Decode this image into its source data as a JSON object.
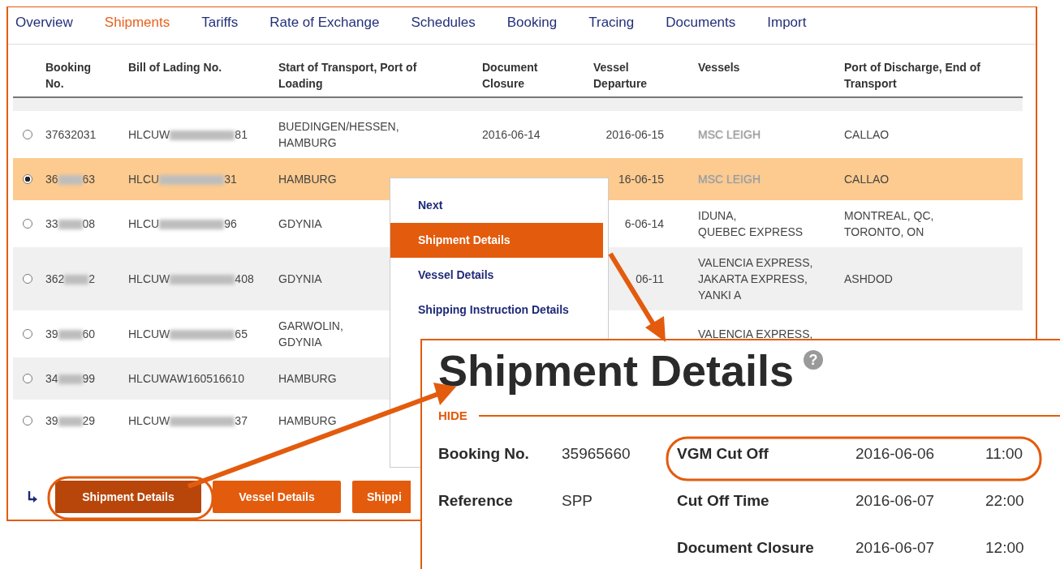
{
  "tabs": [
    {
      "label": "Overview",
      "selected": false
    },
    {
      "label": "Shipments",
      "selected": true
    },
    {
      "label": "Tariffs",
      "selected": false
    },
    {
      "label": "Rate of Exchange",
      "selected": false
    },
    {
      "label": "Schedules",
      "selected": false
    },
    {
      "label": "Booking",
      "selected": false
    },
    {
      "label": "Tracing",
      "selected": false
    },
    {
      "label": "Documents",
      "selected": false
    },
    {
      "label": "Import",
      "selected": false
    }
  ],
  "table": {
    "columns": [
      "Booking No.",
      "Bill of Lading No.",
      "Start of Transport, Port of Loading",
      "Document Closure",
      "Vessel Departure",
      "Vessels",
      "Port of Discharge, End of Transport"
    ],
    "rows": [
      {
        "selected": false,
        "booking_no": [
          "37632031"
        ],
        "bill_of_lading_no": [
          "HLCUW",
          "81"
        ],
        "start_of_transport": [
          "BUEDINGEN/HESSEN,",
          "HAMBURG"
        ],
        "document_closure": [
          "2016-06-14"
        ],
        "vessel_departure": [
          "2016-06-15"
        ],
        "vessels": [
          "MSC LEIGH"
        ],
        "port_of_discharge": [
          "CALLAO"
        ]
      },
      {
        "selected": true,
        "booking_no": [
          "36",
          "63"
        ],
        "bill_of_lading_no": [
          "HLCU",
          "31"
        ],
        "start_of_transport": [
          "HAMBURG"
        ],
        "vessel_departure": [
          "16-06-15"
        ],
        "vessels": [
          "MSC LEIGH"
        ],
        "port_of_discharge": [
          "CALLAO"
        ]
      },
      {
        "selected": false,
        "booking_no": [
          "33",
          "08"
        ],
        "bill_of_lading_no": [
          "HLCU",
          "96"
        ],
        "start_of_transport": [
          "GDYNIA"
        ],
        "vessel_departure": [
          "6-06-14"
        ],
        "vessels": [
          "IDUNA,",
          "QUEBEC EXPRESS"
        ],
        "port_of_discharge": [
          "MONTREAL, QC,",
          "TORONTO, ON"
        ]
      },
      {
        "selected": false,
        "booking_no": [
          "362",
          "2"
        ],
        "bill_of_lading_no": [
          "HLCUW",
          "408"
        ],
        "start_of_transport": [
          "GDYNIA"
        ],
        "vessel_departure": [
          "06-11"
        ],
        "vessels": [
          "VALENCIA EXPRESS,",
          "JAKARTA EXPRESS,",
          "YANKI A"
        ],
        "port_of_discharge": [
          "ASHDOD"
        ]
      },
      {
        "selected": false,
        "booking_no": [
          "39",
          "60"
        ],
        "bill_of_lading_no": [
          "HLCUW",
          "65"
        ],
        "start_of_transport": [
          "GARWOLIN,",
          "GDYNIA"
        ],
        "vessels": [
          "VALENCIA EXPRESS,"
        ]
      },
      {
        "selected": false,
        "booking_no": [
          "34",
          "99"
        ],
        "bill_of_lading_no": [
          "HLCUWAW160516610"
        ],
        "start_of_transport": [
          "HAMBURG"
        ]
      },
      {
        "selected": false,
        "booking_no": [
          "39",
          "29"
        ],
        "bill_of_lading_no": [
          "HLCUW",
          "37"
        ],
        "start_of_transport": [
          "HAMBURG"
        ]
      }
    ]
  },
  "context_menu": [
    {
      "label": "Next",
      "selected": false
    },
    {
      "label": "Shipment Details",
      "selected": true
    },
    {
      "label": "Vessel Details",
      "selected": false
    },
    {
      "label": "Shipping Instruction Details",
      "selected": false
    }
  ],
  "action_buttons": [
    {
      "label": "Shipment Details",
      "selected": true
    },
    {
      "label": "Vessel Details",
      "selected": false
    },
    {
      "label": "Shippi",
      "selected": false
    }
  ],
  "detail_panel": {
    "title": "Shipment Details",
    "help_icon": "?",
    "hide_link": "HIDE",
    "fields_left": [
      {
        "label": "Booking No.",
        "value": "35965660"
      },
      {
        "label": "Reference",
        "value": "SPP"
      }
    ],
    "fields_right": [
      {
        "label": "VGM Cut Off",
        "date": "2016-06-06",
        "time": "11:00"
      },
      {
        "label": "Cut Off Time",
        "date": "2016-06-07",
        "time": "22:00"
      },
      {
        "label": "Document Closure",
        "date": "2016-06-07",
        "time": "12:00"
      }
    ]
  }
}
